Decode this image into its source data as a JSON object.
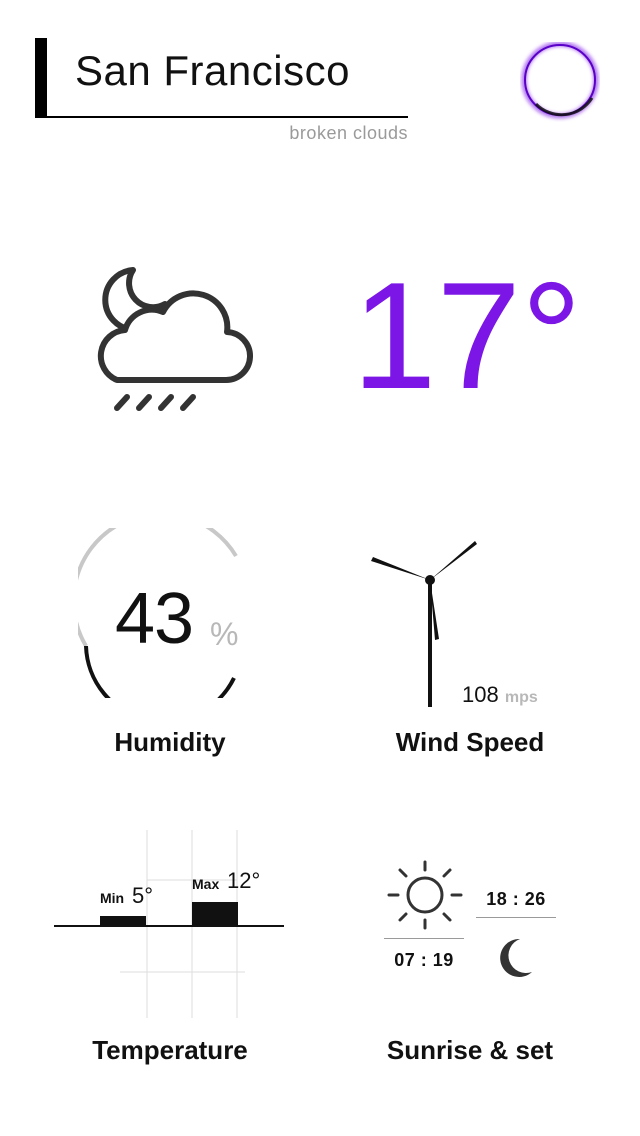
{
  "header": {
    "city": "San Francisco",
    "description": "broken clouds"
  },
  "current": {
    "temperature": "17°",
    "condition_icon": "moon-cloud-rain-icon"
  },
  "humidity": {
    "value": "43",
    "unit": "%",
    "fraction": 0.43,
    "label": "Humidity"
  },
  "wind": {
    "value": "108",
    "unit": "mps",
    "label": "Wind Speed"
  },
  "temperature_range": {
    "min_label": "Min",
    "min_value": "5°",
    "max_label": "Max",
    "max_value": "12°",
    "label": "Temperature"
  },
  "sun": {
    "sunrise": "07 : 19",
    "sunset": "18 : 26",
    "label": "Sunrise & set"
  },
  "colors": {
    "accent": "#7B16E6",
    "text": "#111111",
    "muted": "#9a9a9a"
  }
}
